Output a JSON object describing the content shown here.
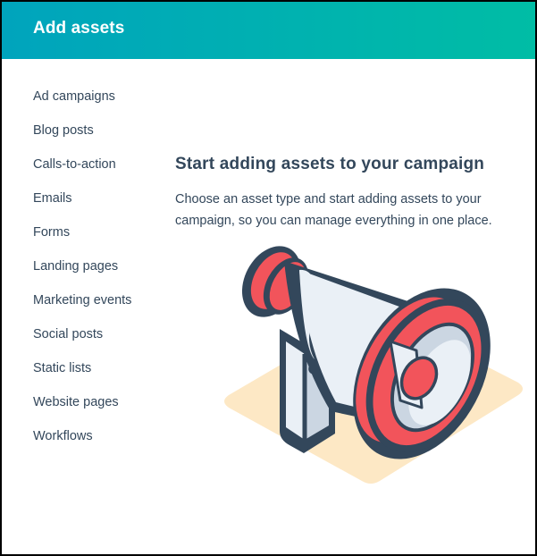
{
  "header": {
    "title": "Add assets",
    "gradient_start": "#00a4bd",
    "gradient_end": "#00bda5"
  },
  "sidebar": {
    "items": [
      {
        "label": "Ad campaigns"
      },
      {
        "label": "Blog posts"
      },
      {
        "label": "Calls-to-action"
      },
      {
        "label": "Emails"
      },
      {
        "label": "Forms"
      },
      {
        "label": "Landing pages"
      },
      {
        "label": "Marketing events"
      },
      {
        "label": "Social posts"
      },
      {
        "label": "Static lists"
      },
      {
        "label": "Website pages"
      },
      {
        "label": "Workflows"
      }
    ]
  },
  "empty_state": {
    "title": "Start adding assets to your campaign",
    "description": "Choose an asset type and start adding assets to your campaign, so you can manage everything in one place.",
    "illustration": "megaphone-illustration"
  },
  "colors": {
    "text": "#33475b",
    "megaphone_red": "#f2545b",
    "megaphone_outline": "#33475b",
    "megaphone_body": "#eaf0f6",
    "megaphone_shade": "#cbd6e2",
    "floor": "#fde8c5"
  }
}
